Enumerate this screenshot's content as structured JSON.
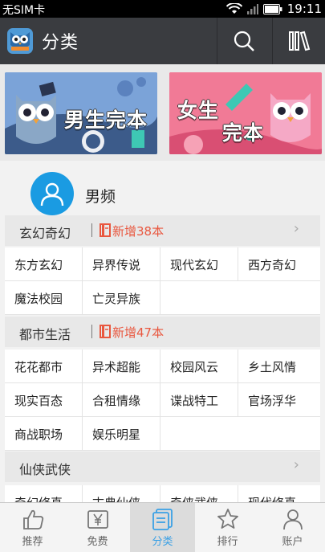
{
  "status_bar": {
    "carrier": "无SIM卡",
    "time": "19:11"
  },
  "app_bar": {
    "title": "分类"
  },
  "banners": [
    {
      "name": "boys",
      "text": "男生完本"
    },
    {
      "name": "girls",
      "text_line1": "女生",
      "text_line2": "完本"
    }
  ],
  "channel": {
    "name": "男频"
  },
  "categories": [
    {
      "name": "玄幻奇幻",
      "new_count": "新增38本",
      "tags": [
        [
          "东方玄幻",
          "异界传说",
          "现代玄幻",
          "西方奇幻"
        ],
        [
          "魔法校园",
          "亡灵异族"
        ]
      ]
    },
    {
      "name": "都市生活",
      "new_count": "新增47本",
      "tags": [
        [
          "花花都市",
          "异术超能",
          "校园风云",
          "乡土风情"
        ],
        [
          "现实百态",
          "合租情缘",
          "谍战特工",
          "官场浮华"
        ],
        [
          "商战职场",
          "娱乐明星"
        ]
      ]
    },
    {
      "name": "仙侠武侠",
      "tags": [
        [
          "奇幻修真",
          "古典仙侠",
          "奇侠武侠",
          "现代修真"
        ]
      ]
    }
  ],
  "bottom_nav": [
    {
      "label": "推荐",
      "icon": "thumbs-up-icon"
    },
    {
      "label": "免费",
      "icon": "yen-tag-icon"
    },
    {
      "label": "分类",
      "icon": "category-icon",
      "active": true
    },
    {
      "label": "排行",
      "icon": "star-icon"
    },
    {
      "label": "账户",
      "icon": "user-icon"
    }
  ],
  "colors": {
    "accent": "#3aa0e5",
    "new_badge": "#e9573f",
    "appbar": "#3a3c40"
  }
}
